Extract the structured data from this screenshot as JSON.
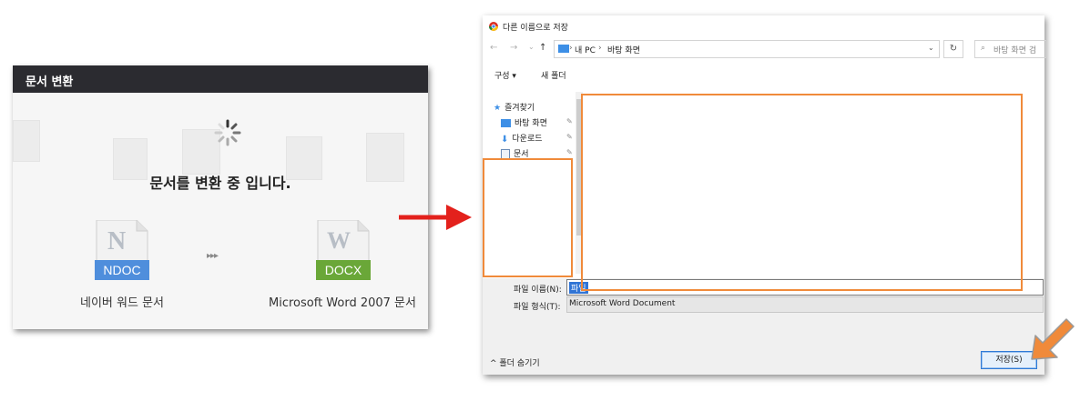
{
  "convert_panel": {
    "title": "문서 변환",
    "message": "문서를 변환 중 입니다.",
    "source_badge": "NDOC",
    "source_letter": "N",
    "source_label": "네이버 워드 문서",
    "target_badge": "DOCX",
    "target_letter": "W",
    "target_label": "Microsoft Word 2007 문서",
    "progress_arrows": "▸▸▸",
    "colors": {
      "titlebar": "#2b2b30",
      "ndoc": "#4f8edc",
      "docx": "#6aa738"
    }
  },
  "save_dialog": {
    "title": "다른 이름으로 저장",
    "nav": {
      "back": "←",
      "forward": "→",
      "recent": "⌄",
      "up": "↑"
    },
    "breadcrumb": [
      "내 PC",
      "바탕 화면"
    ],
    "search_placeholder": "바탕 화면 검",
    "toolbar": {
      "organize": "구성 ▾",
      "new_folder": "새 폴더"
    },
    "sidebar": [
      {
        "label": "즐겨찾기",
        "icon": "star-icon"
      },
      {
        "label": "바탕 화면",
        "icon": "desktop-icon"
      },
      {
        "label": "다운로드",
        "icon": "download-icon"
      },
      {
        "label": "문서",
        "icon": "document-icon"
      }
    ],
    "filename_label": "파일 이름(N):",
    "filename_value": "파일",
    "filetype_label": "파일 형식(T):",
    "filetype_value": "Microsoft Word Document",
    "hide_folders": "^ 폴더 숨기기",
    "save_button": "저장(S)",
    "highlight_color": "#f08a3a"
  }
}
